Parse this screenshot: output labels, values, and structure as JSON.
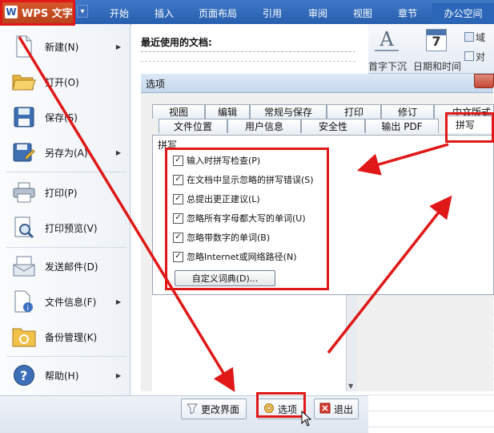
{
  "app": {
    "title": "WPS 文字",
    "logo_letter": "W",
    "dropdown_glyph": "▾"
  },
  "ribbon_tabs": [
    {
      "label": "开始"
    },
    {
      "label": "插入"
    },
    {
      "label": "页面布局"
    },
    {
      "label": "引用"
    },
    {
      "label": "审阅"
    },
    {
      "label": "视图"
    },
    {
      "label": "章节"
    },
    {
      "label": "办公空间"
    }
  ],
  "ribbon_right": {
    "first_char_label": "首字下沉",
    "datetime_label": "日期和时间",
    "domain_label": "域",
    "align_label": "对",
    "calendar_number": "7",
    "a_icon_glyph": "A"
  },
  "file_menu": {
    "items": [
      {
        "label": "新建(N)",
        "icon": "new-document-icon",
        "has_submenu": true
      },
      {
        "label": "打开(O)",
        "icon": "open-folder-icon",
        "has_submenu": false
      },
      {
        "label": "保存(S)",
        "icon": "save-disk-icon",
        "has_submenu": false
      },
      {
        "label": "另存为(A)",
        "icon": "save-as-icon",
        "has_submenu": true
      },
      {
        "label": "打印(P)",
        "icon": "printer-icon",
        "has_submenu": false
      },
      {
        "label": "打印预览(V)",
        "icon": "print-preview-icon",
        "has_submenu": false
      },
      {
        "label": "发送邮件(D)",
        "icon": "send-mail-icon",
        "has_submenu": false
      },
      {
        "label": "文件信息(F)",
        "icon": "file-info-icon",
        "has_submenu": true
      },
      {
        "label": "备份管理(K)",
        "icon": "backup-folder-icon",
        "has_submenu": false
      },
      {
        "label": "帮助(H)",
        "icon": "help-icon",
        "has_submenu": true
      }
    ],
    "recent_title": "最近使用的文档:",
    "bottom": {
      "change_ui_label": "更改界面",
      "options_label": "选项",
      "exit_label": "退出"
    }
  },
  "options_dialog": {
    "title": "选项",
    "tabs_row1": [
      "视图",
      "编辑",
      "常规与保存",
      "打印",
      "修订",
      "中文版式"
    ],
    "tabs_row2": [
      "文件位置",
      "用户信息",
      "安全性",
      "输出 PDF",
      "拼写"
    ],
    "active_tab": "拼写",
    "group_label": "拼写",
    "checkboxes": [
      {
        "label": "输入时拼写检查(P)",
        "checked": true
      },
      {
        "label": "在文档中显示忽略的拼写错误(S)",
        "checked": true
      },
      {
        "label": "总提出更正建议(L)",
        "checked": true
      },
      {
        "label": "忽略所有字母都大写的单词(U)",
        "checked": true
      },
      {
        "label": "忽略带数字的单词(B)",
        "checked": true
      },
      {
        "label": "忽略Internet或网络路径(N)",
        "checked": true
      }
    ],
    "custom_dict_button": "自定义词典(D)...",
    "checkmark": "✓"
  },
  "colors": {
    "annotation_red": "#e01818",
    "ribbon_blue": "#275fae",
    "wps_orange": "#c44a20"
  }
}
